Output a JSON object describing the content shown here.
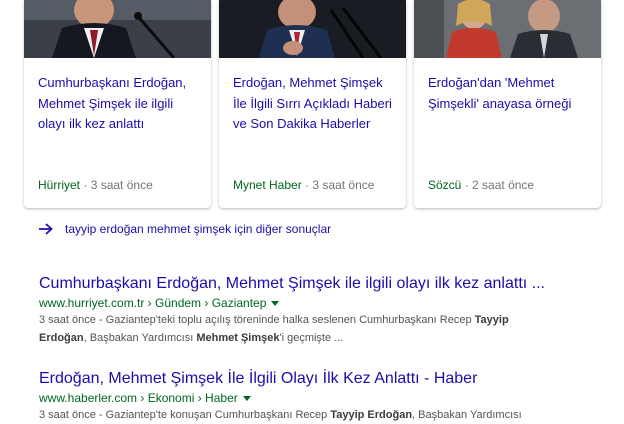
{
  "cards": [
    {
      "title": "Cumhurbaşkanı Erdoğan, Mehmet Şimşek ile ilgili olayı ilk kez anlattı",
      "source": "Hürriyet",
      "time": "3 saat önce"
    },
    {
      "title": "Erdoğan, Mehmet Şimşek İle İlgili Sırrı Açıkladı Haberi ve Son Dakika Haberler",
      "source": "Mynet Haber",
      "time": "3 saat önce"
    },
    {
      "title": "Erdoğan'dan 'Mehmet Şimşekli' anayasa örneği",
      "source": "Sözcü",
      "time": "2 saat önce"
    }
  ],
  "more_results": {
    "label": "tayyip erdoğan mehmet şimşek için diğer sonuçlar",
    "icon": "arrow-right-icon"
  },
  "results": [
    {
      "title": "Cumhurbaşkanı Erdoğan, Mehmet Şimşek ile ilgili olayı ilk kez anlattı ...",
      "url": "www.hurriyet.com.tr › Gündem › Gaziantep",
      "snippet": {
        "age": "3 saat önce",
        "line1_pre": " - Gaziantep'teki toplu açılış töreninde halka seslenen Cumhurbaşkanı Recep ",
        "line1_bold": "Tayyip",
        "line2_bold1": "Erdoğan",
        "line2_mid": ", Başbakan Yardımcısı ",
        "line2_bold2": "Mehmet Şimşek",
        "line2_post": "'i geçmişte ..."
      }
    },
    {
      "title": "Erdoğan, Mehmet Şimşek İle İlgili Olayı İlk Kez Anlattı - Haber",
      "url": "www.haberler.com › Ekonomi › Haber",
      "snippet": {
        "age": "3 saat önce",
        "line1_pre": " - Gaziantep'te konuşan Cumhurbaşkanı Recep ",
        "line1_bold": "Tayyip Erdoğan",
        "line1_post": ", Başbakan Yardımcısı"
      }
    }
  ],
  "colors": {
    "link": "#1a0dab",
    "url": "#006621",
    "meta": "#70757a",
    "snippet": "#545454"
  }
}
